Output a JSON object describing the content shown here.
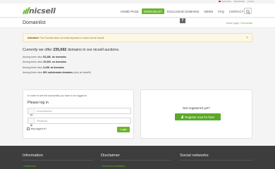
{
  "utility": {
    "lang": "ENGLISH",
    "register": "REGISTER",
    "login": "LOGIN"
  },
  "logo": {
    "text": "nicsell"
  },
  "nav": [
    "HOME PAGE",
    "DOMAINLIST",
    "EXCLUSIVE DOMAINS",
    "NEWS",
    "FAQ",
    "CONTACT"
  ],
  "nav_active_index": 1,
  "page": {
    "title": "Domainlist",
    "breadcrumb_home": "Home page",
    "breadcrumb_sep": "/",
    "breadcrumb_current": "Domainlist"
  },
  "alert": {
    "label": "Attention!",
    "text": "The Domain does not exist anymore or could not be found!",
    "close": "×"
  },
  "offer": {
    "prefix": "Currently we offer",
    "count": "235,692",
    "suffix": "domains in our nicsell auctions.",
    "rows": [
      {
        "pre": "Among them also",
        "value": "53,486 .de domains",
        "post": ""
      },
      {
        "pre": "Among them also",
        "value": "19,300 .eu domains",
        "post": ""
      },
      {
        "pre": "Among them also",
        "value": "3,438 .at domains",
        "post": ""
      },
      {
        "pre": "Among them also",
        "value": "891 subdomain-domains",
        "post": "(only at nicsell!)"
      }
    ]
  },
  "login": {
    "note": "In order to see the domainlist you have to be logged in.",
    "title": "Please log in",
    "email_placeholder": "Email address",
    "password_placeholder": "Password",
    "remember": "stay logged in?",
    "button": "Login"
  },
  "register": {
    "question": "Not registered yet?",
    "button": "Register now for free!"
  },
  "footer": {
    "col1": {
      "title": "Information",
      "link": "› nicsell.com"
    },
    "col2": {
      "title": "Disclaimer",
      "link": "› Terms and conditions"
    },
    "col3": {
      "title": "Social networks",
      "icon": "facebook-icon"
    }
  },
  "colors": {
    "accent": "#6bb52c",
    "footer": "#3d3d3d",
    "alert_bg": "#fcf8e3"
  }
}
